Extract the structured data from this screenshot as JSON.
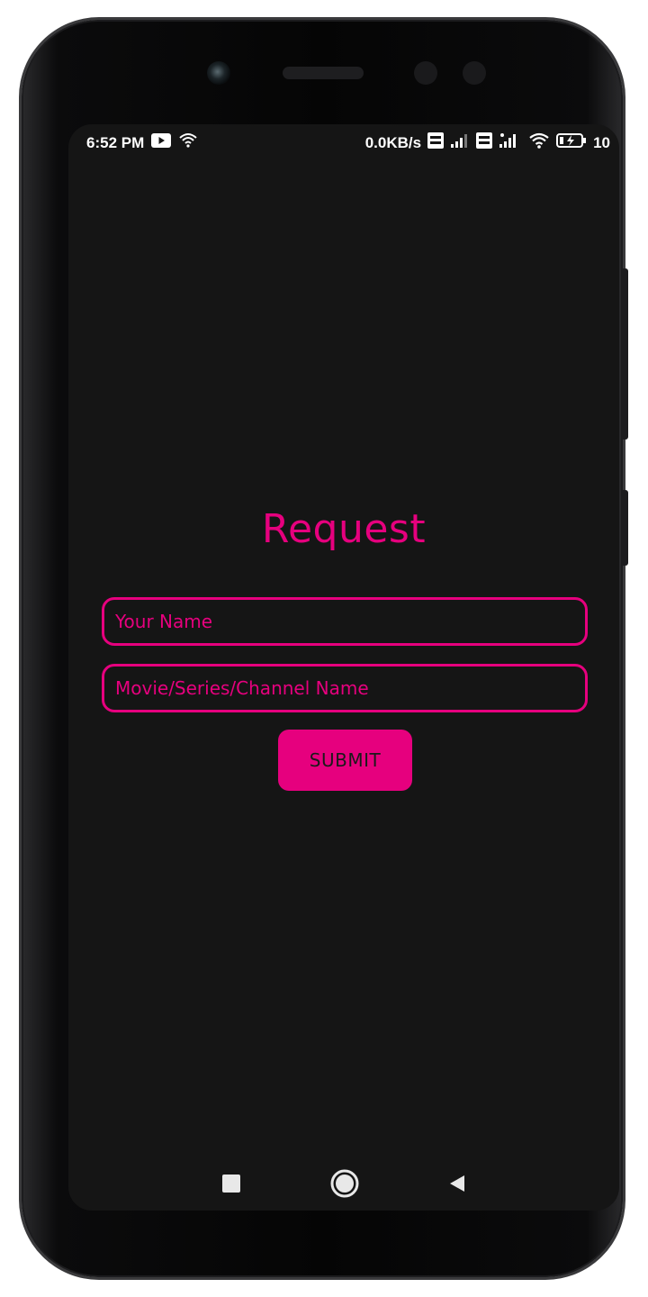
{
  "status_bar": {
    "time": "6:52 PM",
    "network_speed": "0.0KB/s",
    "battery_level": "10",
    "icons": [
      "youtube-icon",
      "wifi-calling-icon",
      "volte-icon",
      "signal-icon",
      "volte-icon",
      "4g-signal-icon",
      "wifi-icon",
      "battery-charging-icon"
    ]
  },
  "page": {
    "title": "Request"
  },
  "form": {
    "name_placeholder": "Your Name",
    "name_value": "",
    "media_placeholder": "Movie/Series/Channel Name",
    "media_value": "",
    "submit_label": "SUBMIT"
  },
  "nav_bar": {
    "icons": [
      "recents-icon",
      "home-icon",
      "back-icon"
    ]
  },
  "colors": {
    "accent": "#e6007e",
    "background": "#151515",
    "button_text": "#1a1a1a"
  }
}
